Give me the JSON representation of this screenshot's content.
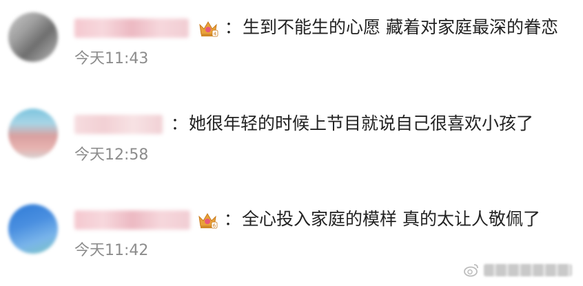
{
  "comments": [
    {
      "time": "今天11:43",
      "text": "生到不能生的心愿 藏着对家庭最深的眷恋",
      "colon": "：",
      "badge_level": "4",
      "badge_icon": "crown-badge-icon"
    },
    {
      "time": "今天12:58",
      "text": "她很年轻的时候上节目就说自己很喜欢小孩了",
      "colon": "："
    },
    {
      "time": "今天11:42",
      "text": "全心投入家庭的模样 真的太让人敬佩了",
      "colon": "：",
      "badge_level": "6",
      "badge_icon": "crown-badge-icon"
    }
  ],
  "colors": {
    "text": "#222222",
    "time": "#8c8c8c",
    "crown_gold": "#e8a23a",
    "crown_pink": "#e8587a"
  },
  "watermark": {
    "icon": "weibo-logo-icon"
  }
}
